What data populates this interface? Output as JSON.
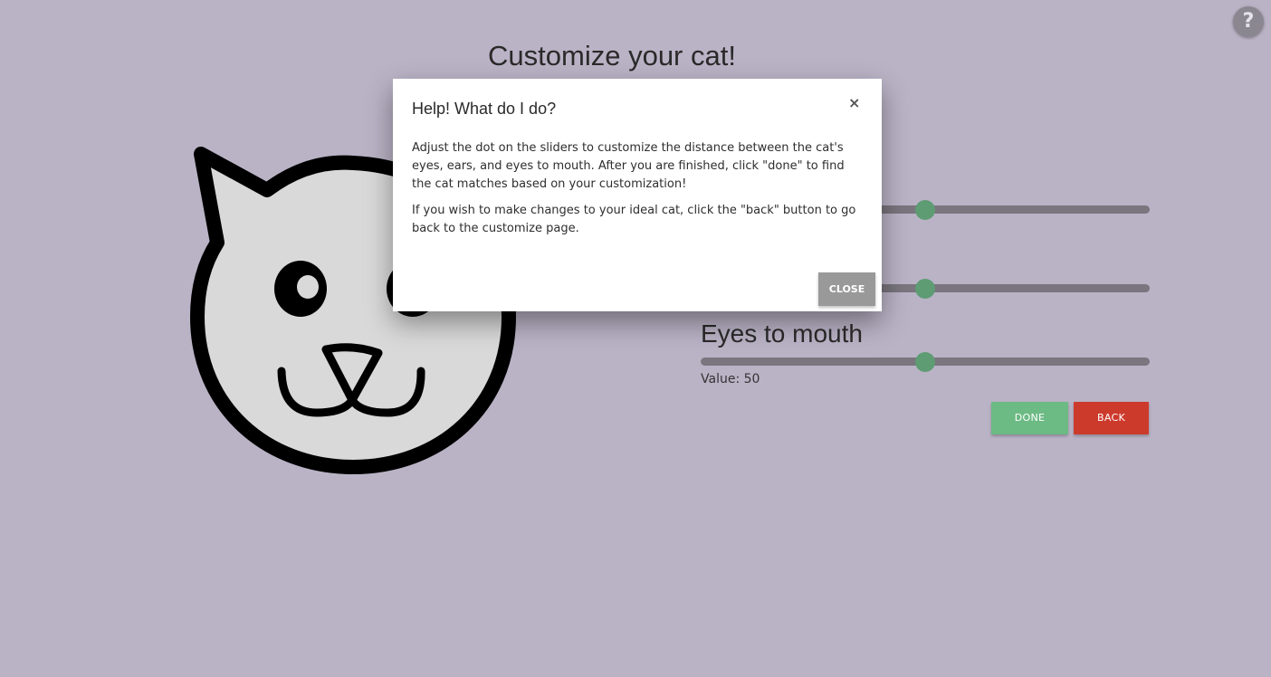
{
  "page": {
    "title": "Customize your cat!",
    "help_button_label": "?"
  },
  "colors": {
    "background": "#bab3c6",
    "slider_track": "#7a757e",
    "slider_thumb": "#5e9c74",
    "done_button": "#6cba84",
    "back_button": "#cc3a2c",
    "modal_close_button": "#999999"
  },
  "sliders": [
    {
      "label": "",
      "value_fraction": 0.5,
      "value_text": ""
    },
    {
      "label": "",
      "value_fraction": 0.5,
      "value_text": ""
    },
    {
      "label": "Eyes to mouth",
      "value_fraction": 0.5,
      "value_text": "Value: 50"
    }
  ],
  "buttons": {
    "done_label": "DONE",
    "back_label": "BACK"
  },
  "modal": {
    "title": "Help! What do I do?",
    "close_x": "×",
    "paragraphs": [
      "Adjust the dot on the sliders to customize the distance between the cat's eyes, ears, and eyes to mouth. After you are finished, click \"done\" to find the cat matches based on your customization!",
      "If you wish to make changes to your ideal cat, click the \"back\" button to go back to the customize page."
    ],
    "close_label": "CLOSE"
  },
  "icons": {
    "help": "question-mark-icon",
    "cat": "cat-face-icon",
    "close": "close-icon"
  }
}
